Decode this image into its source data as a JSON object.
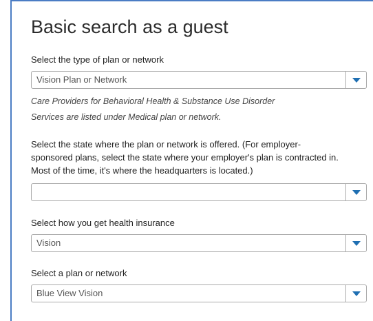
{
  "page": {
    "title": "Basic search as a guest"
  },
  "plan_type": {
    "label": "Select the type of plan or network",
    "value": "Vision Plan or Network",
    "note_line1": "Care Providers for Behavioral Health & Substance Use Disorder",
    "note_line2": "Services are listed under Medical plan or network."
  },
  "state": {
    "label_line1": "Select the state where the plan or network is offered. (For employer-",
    "label_line2": "sponsored plans, select the state where your employer's plan is contracted in.",
    "label_line3": "Most of the time, it's where the headquarters is located.)",
    "value": ""
  },
  "insurance": {
    "label": "Select how you get health insurance",
    "value": "Vision"
  },
  "plan": {
    "label": "Select a plan or network",
    "value": "Blue View Vision"
  },
  "colors": {
    "accent": "#4a7cc4",
    "dropdown_arrow": "#1f6fb2"
  },
  "icons": {
    "dropdown": "caret-down-icon"
  }
}
